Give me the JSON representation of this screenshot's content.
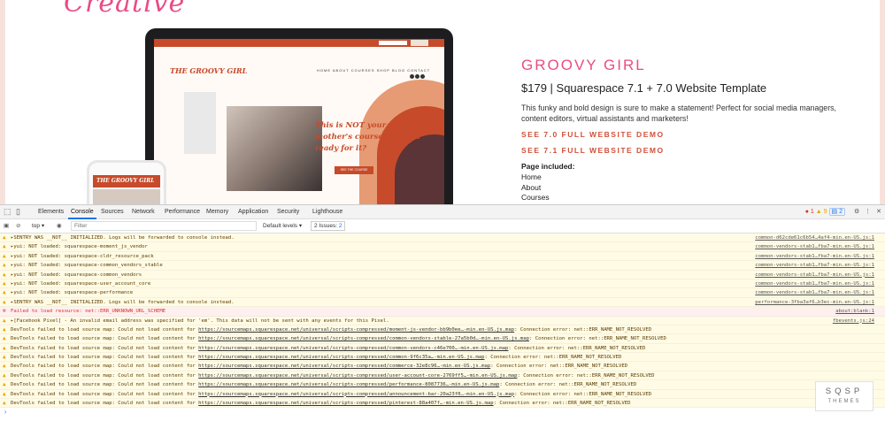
{
  "site": {
    "logo_script": "Creative",
    "laptop": {
      "brand": "THE GROOVY GIRL",
      "nav": "HOME   ABOUT   COURSES   SHOP   BLOG   CONTACT",
      "headline": "This is NOT your mother's course. Are you ready for it?",
      "cta": "SEE THE COURSE"
    },
    "phone_brand": "THE GROOVY GIRL",
    "product": {
      "title": "GROOVY GIRL",
      "price": "$179  |  Squarespace 7.1 + 7.0 Website Template",
      "description": "This funky and bold design is sure to make a statement! Perfect for social media managers, content editors, virtual assistants and marketers!",
      "demo_70": "SEE 7.0 FULL WEBSITE DEMO",
      "demo_71": "SEE 7.1 FULL WEBSITE DEMO",
      "pages_heading": "Page included:",
      "pages": [
        "Home",
        "About",
        "Courses"
      ]
    }
  },
  "devtools": {
    "tabs": [
      "Elements",
      "Console",
      "Sources",
      "Network",
      "Performance",
      "Memory",
      "Application",
      "Security",
      "Lighthouse"
    ],
    "active_tab": "Console",
    "error_count": "1",
    "warning_count": "9",
    "issue_count": "2",
    "toolbar": {
      "context": "top",
      "filter_placeholder": "Filter",
      "levels": "Default levels",
      "issues": "2 Issues:",
      "issues_count": "2"
    },
    "logs": [
      {
        "level": "warn",
        "text": "▸SENTRY WAS __NOT__ INITIALIZED. Logs will be forwarded to console instead.",
        "source": "common-d62cde61c6b54…4af4-min.en-US.js:1"
      },
      {
        "level": "warn",
        "text": "▸yui: NOT loaded: squarespace-moment_js_vendor",
        "source": "common-vendors-stab1…fba7-min.en-US.js:1"
      },
      {
        "level": "warn",
        "text": "▸yui: NOT loaded: squarespace-cldr_resource_pack",
        "source": "common-vendors-stab1…fba7-min.en-US.js:1"
      },
      {
        "level": "warn",
        "text": "▸yui: NOT loaded: squarespace-common_vendors_stable",
        "source": "common-vendors-stab1…fba7-min.en-US.js:1"
      },
      {
        "level": "warn",
        "text": "▸yui: NOT loaded: squarespace-common_vendors",
        "source": "common-vendors-stab1…fba7-min.en-US.js:1"
      },
      {
        "level": "warn",
        "text": "▸yui: NOT loaded: squarespace-user_account_core",
        "source": "common-vendors-stab1…fba7-min.en-US.js:1"
      },
      {
        "level": "warn",
        "text": "▸yui: NOT loaded: squarespace-performance",
        "source": "common-vendors-stab1…fba7-min.en-US.js:1"
      },
      {
        "level": "warn",
        "text": "▸SENTRY WAS __NOT__ INITIALIZED. Logs will be forwarded to console instead.",
        "source": "performance-3fba3af6…b3ec-min.en-US.js:1"
      },
      {
        "level": "error",
        "text": "Failed to load resource: net::ERR_UNKNOWN_URL_SCHEME",
        "source": "about:blank:1"
      },
      {
        "level": "warn",
        "text": "▸[Facebook Pixel] - An invalid email address was specified for 'em'. This data will not be sent with any events for this Pixel.",
        "source": "fbevents.js:24"
      },
      {
        "level": "warn",
        "text": "DevTools failed to load source map: Could not load content for ",
        "url": "https://sourcemaps.squarespace.net/universal/scripts-compressed/moment-js-vendor-bb9b0ee…-min.en-US.js.map",
        "tail": ": Connection error: net::ERR_NAME_NOT_RESOLVED"
      },
      {
        "level": "warn",
        "text": "DevTools failed to load source map: Could not load content for ",
        "url": "https://sourcemaps.squarespace.net/universal/scripts-compressed/common-vendors-stable-27a5b0d…-min.en-US.js.map",
        "tail": ": Connection error: net::ERR_NAME_NOT_RESOLVED"
      },
      {
        "level": "warn",
        "text": "DevTools failed to load source map: Could not load content for ",
        "url": "https://sourcemaps.squarespace.net/universal/scripts-compressed/common-vendors-c46e700…-min.en-US.js.map",
        "tail": ": Connection error: net::ERR_NAME_NOT_RESOLVED"
      },
      {
        "level": "warn",
        "text": "DevTools failed to load source map: Could not load content for ",
        "url": "https://sourcemaps.squarespace.net/universal/scripts-compressed/common-9f6c35a…-min.en-US.js.map",
        "tail": ": Connection error: net::ERR_NAME_NOT_RESOLVED"
      },
      {
        "level": "warn",
        "text": "DevTools failed to load source map: Could not load content for ",
        "url": "https://sourcemaps.squarespace.net/universal/scripts-compressed/commerce-32e8c96…-min.en-US.js.map",
        "tail": ": Connection error: net::ERR_NAME_NOT_RESOLVED"
      },
      {
        "level": "warn",
        "text": "DevTools failed to load source map: Could not load content for ",
        "url": "https://sourcemaps.squarespace.net/universal/scripts-compressed/user-account-core-2769ff5…-min.en-US.js.map",
        "tail": ": Connection error: net::ERR_NAME_NOT_RESOLVED"
      },
      {
        "level": "warn",
        "text": "DevTools failed to load source map: Could not load content for ",
        "url": "https://sourcemaps.squarespace.net/universal/scripts-compressed/performance-8087736…-min.en-US.js.map",
        "tail": ": Connection error: net::ERR_NAME_NOT_RESOLVED"
      },
      {
        "level": "warn",
        "text": "DevTools failed to load source map: Could not load content for ",
        "url": "https://sourcemaps.squarespace.net/universal/scripts-compressed/announcement-bar-20a23f0…-min.en-US.js.map",
        "tail": ": Connection error: net::ERR_NAME_NOT_RESOLVED"
      },
      {
        "level": "warn",
        "text": "DevTools failed to load source map: Could not load content for ",
        "url": "https://sourcemaps.squarespace.net/universal/scripts-compressed/pinterest-88a407f…-min.en-US.js.map",
        "tail": ": Connection error: net::ERR_NAME_NOT_RESOLVED"
      }
    ],
    "prompt": "›"
  },
  "watermark": {
    "line1": "SQSP",
    "line2": "THEMES"
  },
  "colors": {
    "brand_pink": "#e94c86",
    "terracotta": "#c74a2a",
    "warn_bg": "#fffbe5",
    "error_bg": "#fff0f0",
    "accent_blue": "#1a73e8"
  }
}
